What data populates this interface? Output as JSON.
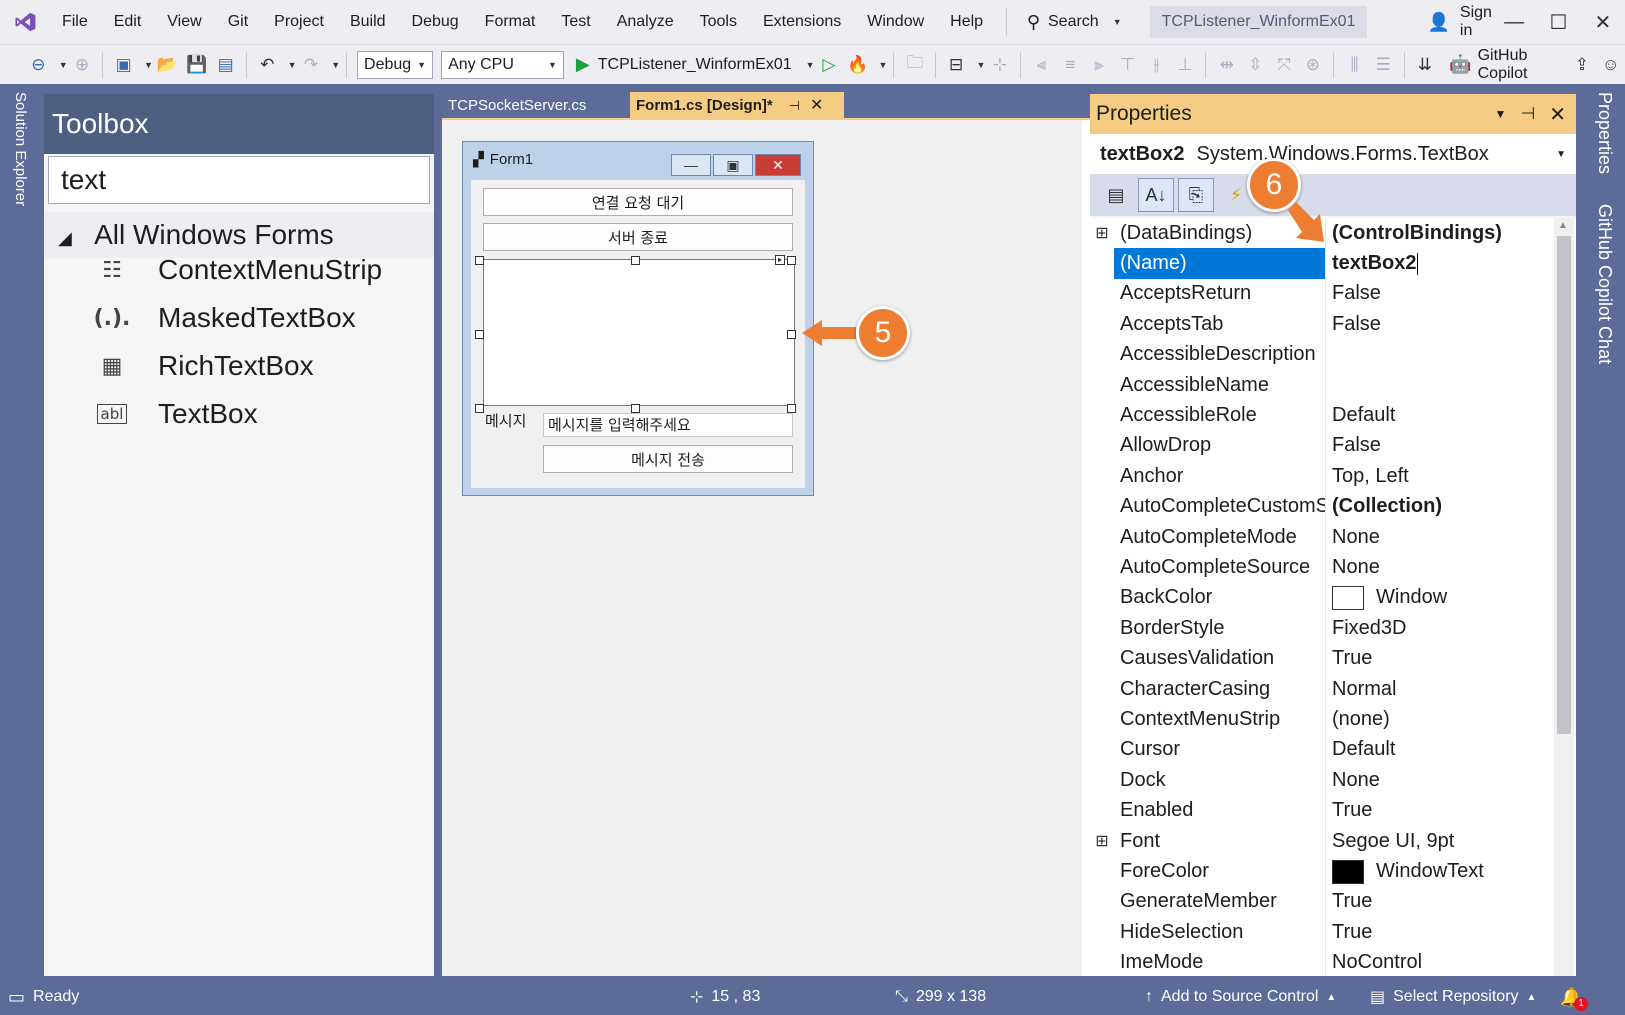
{
  "menu": [
    "File",
    "Edit",
    "View",
    "Git",
    "Project",
    "Build",
    "Debug",
    "Format",
    "Test",
    "Analyze",
    "Tools",
    "Extensions",
    "Window",
    "Help"
  ],
  "search_label": "Search",
  "window_title": "TCPListener_WinformEx01",
  "sign_in": "Sign in",
  "toolbar": {
    "config": "Debug",
    "platform": "Any CPU",
    "startup_project": "TCPListener_WinformEx01",
    "copilot": "GitHub Copilot"
  },
  "left_tabs": {
    "solution_explorer": "Solution Explorer"
  },
  "right_tabs": {
    "properties": "Properties",
    "copilot_chat": "GitHub Copilot Chat"
  },
  "toolbox": {
    "title": "Toolbox",
    "search_value": "text",
    "group": "All Windows Forms",
    "items": [
      {
        "label": "ContextMenuStrip",
        "icon": "context-menu-strip-icon"
      },
      {
        "label": "MaskedTextBox",
        "icon": "masked-textbox-icon"
      },
      {
        "label": "RichTextBox",
        "icon": "rich-textbox-icon"
      },
      {
        "label": "TextBox",
        "icon": "textbox-icon"
      }
    ]
  },
  "editor_tabs": [
    {
      "label": "TCPSocketServer.cs",
      "active": false
    },
    {
      "label": "Form1.cs [Design]*",
      "active": true
    }
  ],
  "designer": {
    "form_title": "Form1",
    "btn_wait": "연결 요청 대기",
    "btn_stop": "서버 종료",
    "label_message": "메시지",
    "message_input": "메시지를 입력해주세요",
    "btn_send": "메시지 전송"
  },
  "callouts": {
    "five": "5",
    "six": "6"
  },
  "properties": {
    "title": "Properties",
    "object_name": "textBox2",
    "object_type": "System.Windows.Forms.TextBox",
    "rows": [
      {
        "name": "(DataBindings)",
        "value": "(ControlBindings)",
        "expand": "⊞",
        "bold": true
      },
      {
        "name": "(Name)",
        "value": "textBox2",
        "selected": true,
        "bold": true
      },
      {
        "name": "AcceptsReturn",
        "value": "False"
      },
      {
        "name": "AcceptsTab",
        "value": "False"
      },
      {
        "name": "AccessibleDescription",
        "value": ""
      },
      {
        "name": "AccessibleName",
        "value": ""
      },
      {
        "name": "AccessibleRole",
        "value": "Default"
      },
      {
        "name": "AllowDrop",
        "value": "False"
      },
      {
        "name": "Anchor",
        "value": "Top, Left"
      },
      {
        "name": "AutoCompleteCustomS",
        "value": "(Collection)",
        "bold": true
      },
      {
        "name": "AutoCompleteMode",
        "value": "None"
      },
      {
        "name": "AutoCompleteSource",
        "value": "None"
      },
      {
        "name": "BackColor",
        "value": "Window",
        "swatch": "#ffffff"
      },
      {
        "name": "BorderStyle",
        "value": "Fixed3D"
      },
      {
        "name": "CausesValidation",
        "value": "True"
      },
      {
        "name": "CharacterCasing",
        "value": "Normal"
      },
      {
        "name": "ContextMenuStrip",
        "value": "(none)"
      },
      {
        "name": "Cursor",
        "value": "Default"
      },
      {
        "name": "Dock",
        "value": "None"
      },
      {
        "name": "Enabled",
        "value": "True"
      },
      {
        "name": "Font",
        "value": "Segoe UI, 9pt",
        "expand": "⊞"
      },
      {
        "name": "ForeColor",
        "value": "WindowText",
        "swatch": "#000000"
      },
      {
        "name": "GenerateMember",
        "value": "True"
      },
      {
        "name": "HideSelection",
        "value": "True"
      },
      {
        "name": "ImeMode",
        "value": "NoControl"
      }
    ]
  },
  "status": {
    "ready": "Ready",
    "position": "15 , 83",
    "size": "299 x 138",
    "source_control": "Add to Source Control",
    "repository": "Select Repository",
    "notification_count": "1"
  },
  "colors": {
    "accent": "#5d6b99",
    "properties_title": "#f5cc84",
    "selection": "#0078d7",
    "callout": "#ed7d31"
  }
}
